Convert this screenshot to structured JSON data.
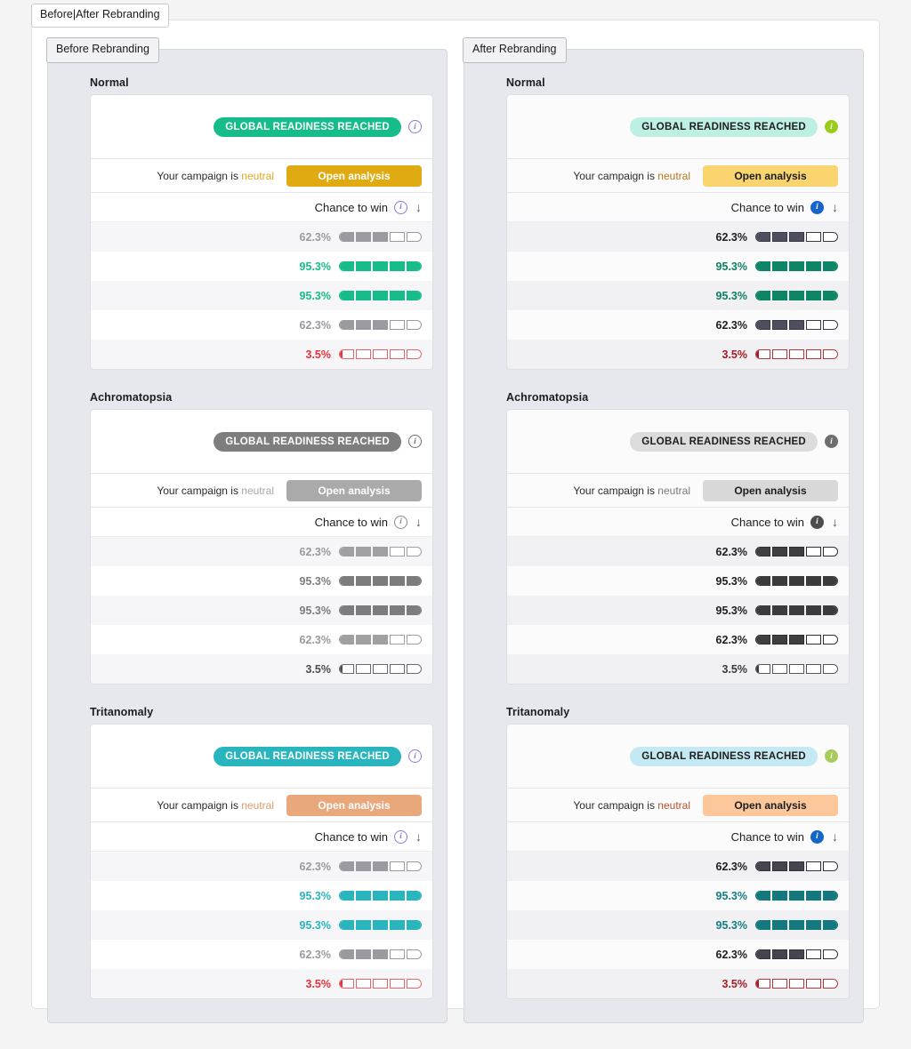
{
  "window": {
    "root_tab_label": "Before|After Rebranding"
  },
  "theme": {
    "page_background": "#f4f4f4",
    "frame_background": "#ffffff",
    "panel_background": "#e7e7ee",
    "card_background": "#ffffff"
  },
  "panels": [
    {
      "tab_label": "Before Rebranding",
      "card_bg": "#ffffff",
      "row_alt_bg": "#f6f6f8",
      "groups": [
        {
          "sim_label": "Normal",
          "badge": {
            "text": "GLOBAL READINESS REACHED",
            "bg": "#16bd8a",
            "fg": "#ffffff",
            "info_bg": "#ffffff",
            "info_fg": "#8b79d6",
            "info_border": "#8b79d6",
            "info_glyph": "i"
          },
          "campaign": {
            "prefix": "Your campaign is ",
            "keyword": "neutral",
            "keyword_color": "#e0a91b",
            "button_label": "Open analysis",
            "button_bg": "#e0ab12",
            "button_fg": "#ffffff"
          },
          "table": {
            "header_label": "Chance to win",
            "sort_glyph": "↓",
            "header_info_bg": "#ffffff",
            "header_info_fg": "#8b79d6",
            "header_info_border": "#8b79d6",
            "rows": [
              {
                "value": "62.3%",
                "segments": 5,
                "filled": 3,
                "partial": 0,
                "text_color": "#9a9aa0",
                "bar_color": "#9a9aa0",
                "bar_border": "#9a9aa0"
              },
              {
                "value": "95.3%",
                "segments": 5,
                "filled": 5,
                "partial": 0,
                "text_color": "#16bd8a",
                "bar_color": "#16bd8a",
                "bar_border": "#16bd8a"
              },
              {
                "value": "95.3%",
                "segments": 5,
                "filled": 5,
                "partial": 0,
                "text_color": "#16bd8a",
                "bar_color": "#16bd8a",
                "bar_border": "#16bd8a"
              },
              {
                "value": "62.3%",
                "segments": 5,
                "filled": 3,
                "partial": 0,
                "text_color": "#9a9aa0",
                "bar_color": "#9a9aa0",
                "bar_border": "#9a9aa0"
              },
              {
                "value": "3.5%",
                "segments": 5,
                "filled": 0,
                "partial": 18,
                "text_color": "#e8323c",
                "bar_color": "#e8323c",
                "bar_border": "#e8646c"
              }
            ]
          }
        },
        {
          "sim_label": "Achromatopsia",
          "badge": {
            "text": "GLOBAL READINESS REACHED",
            "bg": "#7e7e7e",
            "fg": "#ffffff",
            "info_bg": "#ffffff",
            "info_fg": "#6e6e6e",
            "info_border": "#6e6e6e",
            "info_glyph": "i"
          },
          "campaign": {
            "prefix": "Your campaign is ",
            "keyword": "neutral",
            "keyword_color": "#a5a5a5",
            "button_label": "Open analysis",
            "button_bg": "#aaaaaa",
            "button_fg": "#ffffff"
          },
          "table": {
            "header_label": "Chance to win",
            "sort_glyph": "↓",
            "header_info_bg": "#ffffff",
            "header_info_fg": "#8a8a8a",
            "header_info_border": "#8a8a8a",
            "rows": [
              {
                "value": "62.3%",
                "segments": 5,
                "filled": 3,
                "partial": 0,
                "text_color": "#9a9a9a",
                "bar_color": "#a0a0a0",
                "bar_border": "#a0a0a0"
              },
              {
                "value": "95.3%",
                "segments": 5,
                "filled": 5,
                "partial": 0,
                "text_color": "#7c7c7c",
                "bar_color": "#7c7c7c",
                "bar_border": "#7c7c7c"
              },
              {
                "value": "95.3%",
                "segments": 5,
                "filled": 5,
                "partial": 0,
                "text_color": "#7c7c7c",
                "bar_color": "#7c7c7c",
                "bar_border": "#7c7c7c"
              },
              {
                "value": "62.3%",
                "segments": 5,
                "filled": 3,
                "partial": 0,
                "text_color": "#9a9a9a",
                "bar_color": "#a0a0a0",
                "bar_border": "#a0a0a0"
              },
              {
                "value": "3.5%",
                "segments": 5,
                "filled": 0,
                "partial": 18,
                "text_color": "#4e4e4e",
                "bar_color": "#4e4e4e",
                "bar_border": "#6a6a6a"
              }
            ]
          }
        },
        {
          "sim_label": "Tritanomaly",
          "badge": {
            "text": "GLOBAL READINESS REACHED",
            "bg": "#29b5bd",
            "fg": "#ffffff",
            "info_bg": "#ffffff",
            "info_fg": "#8b79d6",
            "info_border": "#8b79d6",
            "info_glyph": "i"
          },
          "campaign": {
            "prefix": "Your campaign is ",
            "keyword": "neutral",
            "keyword_color": "#e09a6b",
            "button_label": "Open analysis",
            "button_bg": "#e8a87c",
            "button_fg": "#ffffff"
          },
          "table": {
            "header_label": "Chance to win",
            "sort_glyph": "↓",
            "header_info_bg": "#ffffff",
            "header_info_fg": "#8b79d6",
            "header_info_border": "#8b79d6",
            "rows": [
              {
                "value": "62.3%",
                "segments": 5,
                "filled": 3,
                "partial": 0,
                "text_color": "#9a9aa0",
                "bar_color": "#9a9aa0",
                "bar_border": "#9a9aa0"
              },
              {
                "value": "95.3%",
                "segments": 5,
                "filled": 5,
                "partial": 0,
                "text_color": "#29b5bd",
                "bar_color": "#29b5bd",
                "bar_border": "#29b5bd"
              },
              {
                "value": "95.3%",
                "segments": 5,
                "filled": 5,
                "partial": 0,
                "text_color": "#29b5bd",
                "bar_color": "#29b5bd",
                "bar_border": "#29b5bd"
              },
              {
                "value": "62.3%",
                "segments": 5,
                "filled": 3,
                "partial": 0,
                "text_color": "#9a9aa0",
                "bar_color": "#9a9aa0",
                "bar_border": "#9a9aa0"
              },
              {
                "value": "3.5%",
                "segments": 5,
                "filled": 0,
                "partial": 18,
                "text_color": "#e8323c",
                "bar_color": "#e8323c",
                "bar_border": "#e8646c"
              }
            ]
          }
        }
      ]
    },
    {
      "tab_label": "After Rebranding",
      "card_bg": "#fbfbfc",
      "row_alt_bg": "#f1f1f4",
      "groups": [
        {
          "sim_label": "Normal",
          "badge": {
            "text": "GLOBAL READINESS REACHED",
            "bg": "#bdefe3",
            "fg": "#1d1d1f",
            "info_bg": "#9acd19",
            "info_fg": "#ffffff",
            "info_border": "#9acd19",
            "info_glyph": "i"
          },
          "campaign": {
            "prefix": "Your campaign is ",
            "keyword": "neutral",
            "keyword_color": "#b5761a",
            "button_label": "Open analysis",
            "button_bg": "#fad46e",
            "button_fg": "#1d1d1f"
          },
          "table": {
            "header_label": "Chance to win",
            "sort_glyph": "↓",
            "header_info_bg": "#1663cc",
            "header_info_fg": "#ffffff",
            "header_info_border": "#1663cc",
            "rows": [
              {
                "value": "62.3%",
                "segments": 5,
                "filled": 3,
                "partial": 0,
                "text_color": "#1d1d1f",
                "bar_color": "#4e4e5e",
                "bar_border": "#3a3a46"
              },
              {
                "value": "95.3%",
                "segments": 5,
                "filled": 5,
                "partial": 0,
                "text_color": "#0e7f61",
                "bar_color": "#0e8566",
                "bar_border": "#0e8566"
              },
              {
                "value": "95.3%",
                "segments": 5,
                "filled": 5,
                "partial": 0,
                "text_color": "#0e7f61",
                "bar_color": "#0e8566",
                "bar_border": "#0e8566"
              },
              {
                "value": "62.3%",
                "segments": 5,
                "filled": 3,
                "partial": 0,
                "text_color": "#1d1d1f",
                "bar_color": "#4e4e5e",
                "bar_border": "#3a3a46"
              },
              {
                "value": "3.5%",
                "segments": 5,
                "filled": 0,
                "partial": 18,
                "text_color": "#a81b22",
                "bar_color": "#a81b22",
                "bar_border": "#b5373d"
              }
            ]
          }
        },
        {
          "sim_label": "Achromatopsia",
          "badge": {
            "text": "GLOBAL READINESS REACHED",
            "bg": "#dcdcdc",
            "fg": "#1d1d1f",
            "info_bg": "#6e6e6e",
            "info_fg": "#ffffff",
            "info_border": "#6e6e6e",
            "info_glyph": "i"
          },
          "campaign": {
            "prefix": "Your campaign is ",
            "keyword": "neutral",
            "keyword_color": "#7a7a7a",
            "button_label": "Open analysis",
            "button_bg": "#d8d8d8",
            "button_fg": "#1d1d1f"
          },
          "table": {
            "header_label": "Chance to win",
            "sort_glyph": "↓",
            "header_info_bg": "#4d4d4d",
            "header_info_fg": "#ffffff",
            "header_info_border": "#4d4d4d",
            "rows": [
              {
                "value": "62.3%",
                "segments": 5,
                "filled": 3,
                "partial": 0,
                "text_color": "#1d1d1f",
                "bar_color": "#3f3f3f",
                "bar_border": "#2e2e2e"
              },
              {
                "value": "95.3%",
                "segments": 5,
                "filled": 5,
                "partial": 0,
                "text_color": "#1d1d1f",
                "bar_color": "#3b3b3b",
                "bar_border": "#3b3b3b"
              },
              {
                "value": "95.3%",
                "segments": 5,
                "filled": 5,
                "partial": 0,
                "text_color": "#1d1d1f",
                "bar_color": "#3b3b3b",
                "bar_border": "#3b3b3b"
              },
              {
                "value": "62.3%",
                "segments": 5,
                "filled": 3,
                "partial": 0,
                "text_color": "#1d1d1f",
                "bar_color": "#3f3f3f",
                "bar_border": "#2e2e2e"
              },
              {
                "value": "3.5%",
                "segments": 5,
                "filled": 0,
                "partial": 18,
                "text_color": "#3a3a3a",
                "bar_color": "#3a3a3a",
                "bar_border": "#555555"
              }
            ]
          }
        },
        {
          "sim_label": "Tritanomaly",
          "badge": {
            "text": "GLOBAL READINESS REACHED",
            "bg": "#c5e9f2",
            "fg": "#1d1d1f",
            "info_bg": "#a8cc5c",
            "info_fg": "#ffffff",
            "info_border": "#a8cc5c",
            "info_glyph": "i"
          },
          "campaign": {
            "prefix": "Your campaign is ",
            "keyword": "neutral",
            "keyword_color": "#b5542a",
            "button_label": "Open analysis",
            "button_bg": "#fbc79b",
            "button_fg": "#1d1d1f"
          },
          "table": {
            "header_label": "Chance to win",
            "sort_glyph": "↓",
            "header_info_bg": "#1466c4",
            "header_info_fg": "#ffffff",
            "header_info_border": "#1466c4",
            "rows": [
              {
                "value": "62.3%",
                "segments": 5,
                "filled": 3,
                "partial": 0,
                "text_color": "#1d1d1f",
                "bar_color": "#45454f",
                "bar_border": "#33333c"
              },
              {
                "value": "95.3%",
                "segments": 5,
                "filled": 5,
                "partial": 0,
                "text_color": "#157d83",
                "bar_color": "#14797f",
                "bar_border": "#14797f"
              },
              {
                "value": "95.3%",
                "segments": 5,
                "filled": 5,
                "partial": 0,
                "text_color": "#157d83",
                "bar_color": "#14797f",
                "bar_border": "#14797f"
              },
              {
                "value": "62.3%",
                "segments": 5,
                "filled": 3,
                "partial": 0,
                "text_color": "#1d1d1f",
                "bar_color": "#45454f",
                "bar_border": "#33333c"
              },
              {
                "value": "3.5%",
                "segments": 5,
                "filled": 0,
                "partial": 18,
                "text_color": "#a81b22",
                "bar_color": "#a81b22",
                "bar_border": "#b5373d"
              }
            ]
          }
        }
      ]
    }
  ]
}
